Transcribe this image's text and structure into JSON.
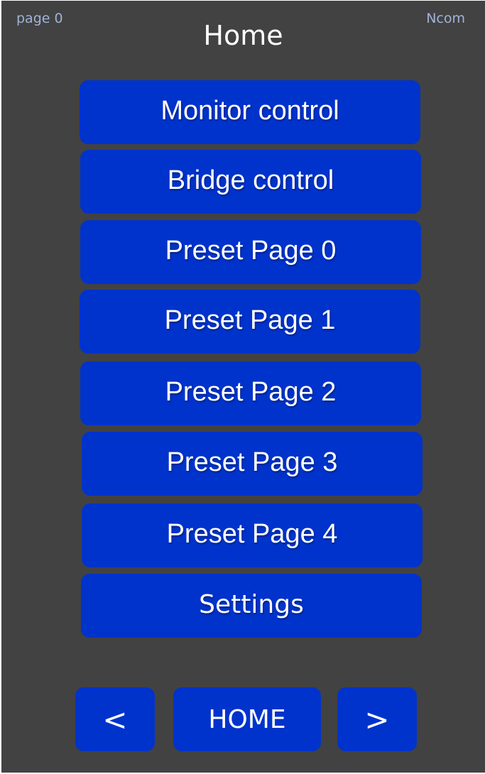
{
  "header": {
    "page_label": "page 0",
    "brand_label": "Ncom",
    "title": "Home"
  },
  "menu": {
    "items": [
      {
        "label": "Monitor control"
      },
      {
        "label": "Bridge control"
      },
      {
        "label": "Preset Page 0"
      },
      {
        "label": "Preset Page 1"
      },
      {
        "label": "Preset Page 2"
      },
      {
        "label": "Preset Page 3"
      },
      {
        "label": "Preset Page 4"
      },
      {
        "label": "Settings"
      }
    ]
  },
  "nav": {
    "prev_label": "<",
    "home_label": "HOME",
    "next_label": ">"
  },
  "colors": {
    "background": "#424242",
    "button": "#0033cc",
    "corner_text": "#9fb3d8",
    "text": "#ffffff"
  }
}
